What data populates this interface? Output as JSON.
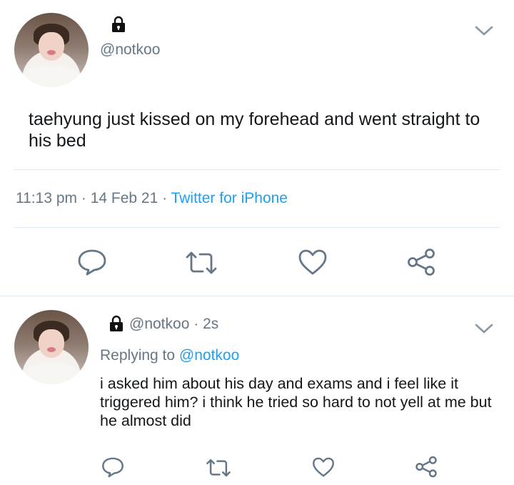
{
  "main_tweet": {
    "handle": "@notkoo",
    "text": "taehyung just kissed on my forehead and went straight to his bed",
    "time": "11:13 pm",
    "sep1": "·",
    "date": "14 Feb 21",
    "sep2": "·",
    "source": "Twitter for iPhone"
  },
  "reply_tweet": {
    "handle": "@notkoo",
    "sep": "·",
    "age": "2s",
    "replying_prefix": "Replying to",
    "replying_handle": "@notkoo",
    "text": "i asked him about his day and exams and i feel like it triggered him? i think he tried so hard to not yell at me but he almost did"
  },
  "icons": {
    "lock": "lock-icon",
    "chevron": "chevron-down-icon",
    "reply": "reply-icon",
    "retweet": "retweet-icon",
    "like": "heart-icon",
    "share": "share-icon"
  },
  "colors": {
    "text": "#14171a",
    "secondary": "#657786",
    "link": "#1da1f2",
    "divider": "#e1e8ed"
  }
}
